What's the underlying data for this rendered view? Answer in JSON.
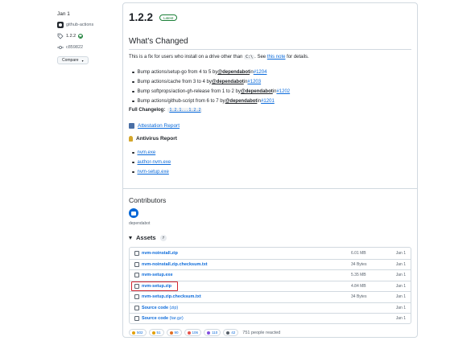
{
  "meta": {
    "date": "Jan 1",
    "author": "github-actions",
    "tag": "1.2.2",
    "commit": "c859822",
    "compare_label": "Compare"
  },
  "release": {
    "title": "1.2.2",
    "badge": "Latest",
    "heading": "What's Changed",
    "intro_before": "This is a fix for users who install on a drive other than ",
    "intro_code": "C:\\",
    "intro_mid": ". See ",
    "intro_link": "this note",
    "intro_after": " for details.",
    "changes": [
      {
        "text": "Bump actions/setup-go from 4 to 5 by ",
        "user": "@dependabot",
        "in": " in ",
        "pr": "#1204"
      },
      {
        "text": "Bump actions/cache from 3 to 4 by ",
        "user": "@dependabot",
        "in": " in ",
        "pr": "#1203"
      },
      {
        "text": "Bump softprops/action-gh-release from 1 to 2 by ",
        "user": "@dependabot",
        "in": " in ",
        "pr": "#1202"
      },
      {
        "text": "Bump actions/github-script from 6 to 7 by ",
        "user": "@dependabot",
        "in": " in ",
        "pr": "#1201"
      }
    ],
    "changelog_label": "Full Changelog:",
    "changelog_link": "1.2.1...1.2.2",
    "attestation": "Attestation Report",
    "antivirus": "Antivirus Report",
    "av_links": [
      "nvm.exe",
      "author-nvm.exe",
      "nvm-setup.exe"
    ]
  },
  "contributors": {
    "heading": "Contributors",
    "name": "dependabot"
  },
  "assets": {
    "heading": "Assets",
    "count": "7",
    "items": [
      {
        "name": "nvm-noinstall.zip",
        "paren": "",
        "size": "6.01 MB",
        "date": "Jan 1"
      },
      {
        "name": "nvm-noinstall.zip.checksum.txt",
        "paren": "",
        "size": "34 Bytes",
        "date": "Jan 1"
      },
      {
        "name": "nvm-setup.exe",
        "paren": "",
        "size": "5.35 MB",
        "date": "Jan 1"
      },
      {
        "name": "nvm-setup.zip",
        "paren": "",
        "size": "4.84 MB",
        "date": "Jan 1"
      },
      {
        "name": "nvm-setup.zip.checksum.txt",
        "paren": "",
        "size": "34 Bytes",
        "date": "Jan 1"
      },
      {
        "name": "Source code",
        "paren": "(zip)",
        "size": "",
        "date": "Jan 1"
      },
      {
        "name": "Source code",
        "paren": "(tar.gz)",
        "size": "",
        "date": "Jan 1"
      }
    ]
  },
  "reactions": {
    "items": [
      {
        "icon": "thumbs-up-icon",
        "count": "502",
        "color": "#e3a008"
      },
      {
        "icon": "laugh-icon",
        "count": "51",
        "color": "#e3a008"
      },
      {
        "icon": "tada-icon",
        "count": "90",
        "color": "#e16f24"
      },
      {
        "icon": "heart-icon",
        "count": "106",
        "color": "#e5534b"
      },
      {
        "icon": "rocket-icon",
        "count": "110",
        "color": "#8250df"
      },
      {
        "icon": "eyes-icon",
        "count": "42",
        "color": "#57606a"
      }
    ],
    "people": "751 people reacted"
  }
}
